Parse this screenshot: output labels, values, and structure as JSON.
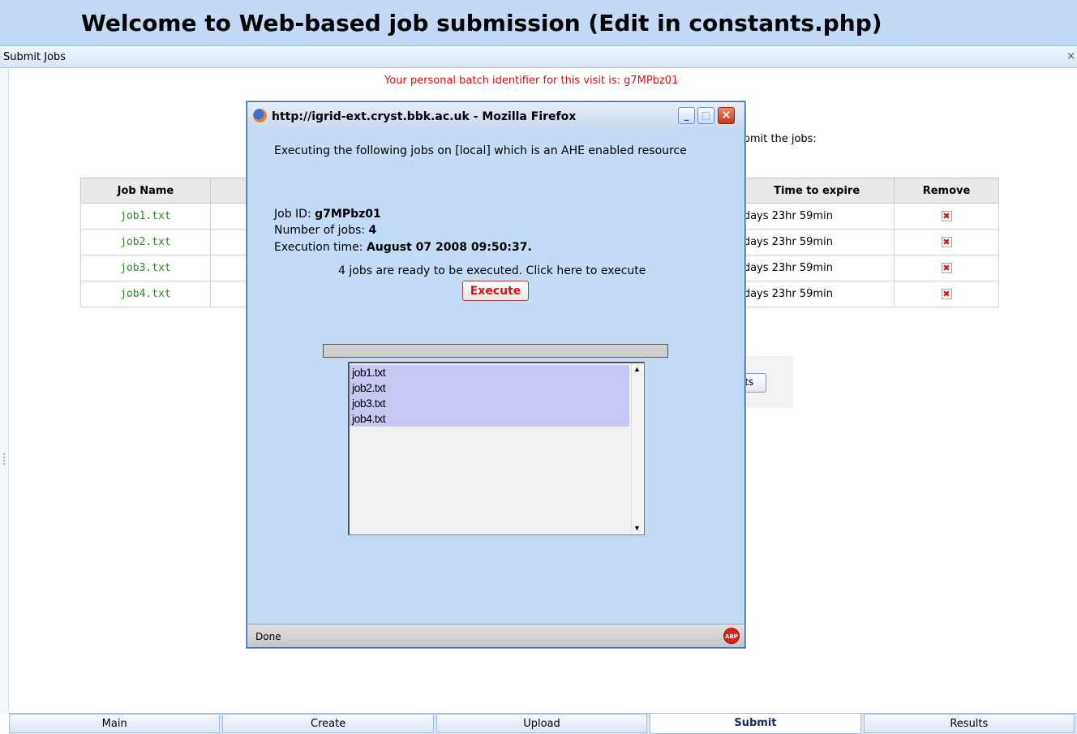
{
  "banner": {
    "title": "Welcome to Web-based job submission (Edit in constants.php)"
  },
  "panel": {
    "title": "Submit Jobs",
    "close": "×"
  },
  "batch_identifier": "Your personal batch identifier for this visit is: g7MPbz01",
  "background_text": {
    "submit_jobs_fragment": "ıbmit the jobs:",
    "results_button_fragment": "lts"
  },
  "jobs_table": {
    "headers": {
      "job_name": "Job Name",
      "time_to_expire": "Time to expire",
      "remove": "Remove"
    },
    "rows": [
      {
        "name": "job1.txt",
        "expire": "ıdays 23hr 59min"
      },
      {
        "name": "job2.txt",
        "expire": "ıdays 23hr 59min"
      },
      {
        "name": "job3.txt",
        "expire": "ıdays 23hr 59min"
      },
      {
        "name": "job4.txt",
        "expire": "ıdays 23hr 59min"
      }
    ],
    "remove_glyph": "✖"
  },
  "popup": {
    "title": "http://igrid-ext.cryst.bbk.ac.uk - Mozilla Firefox",
    "heading": "Executing the following jobs on [local] which is an AHE enabled resource",
    "job_id_label": "Job ID:",
    "job_id_value": "g7MPbz01",
    "num_jobs_label": "Number of jobs:",
    "num_jobs_value": "4",
    "exec_time_label": "Execution time:",
    "exec_time_value": "August 07 2008 09:50:37.",
    "ready_text": "4 jobs are ready to be executed. Click here to execute",
    "execute_label": "Execute",
    "progress": 0,
    "list_items": [
      "job1.txt",
      "job2.txt",
      "job3.txt",
      "job4.txt"
    ],
    "status": "Done",
    "abp_label": "ABP"
  },
  "tabs": [
    {
      "label": "Main",
      "active": false
    },
    {
      "label": "Create",
      "active": false
    },
    {
      "label": "Upload",
      "active": false
    },
    {
      "label": "Submit",
      "active": true
    },
    {
      "label": "Results",
      "active": false
    }
  ],
  "colors": {
    "banner": "#c3d9f5",
    "popup_bg": "#c3dbf6",
    "batch_id_red": "#e01010",
    "job_name_green": "#2a8a2a"
  }
}
